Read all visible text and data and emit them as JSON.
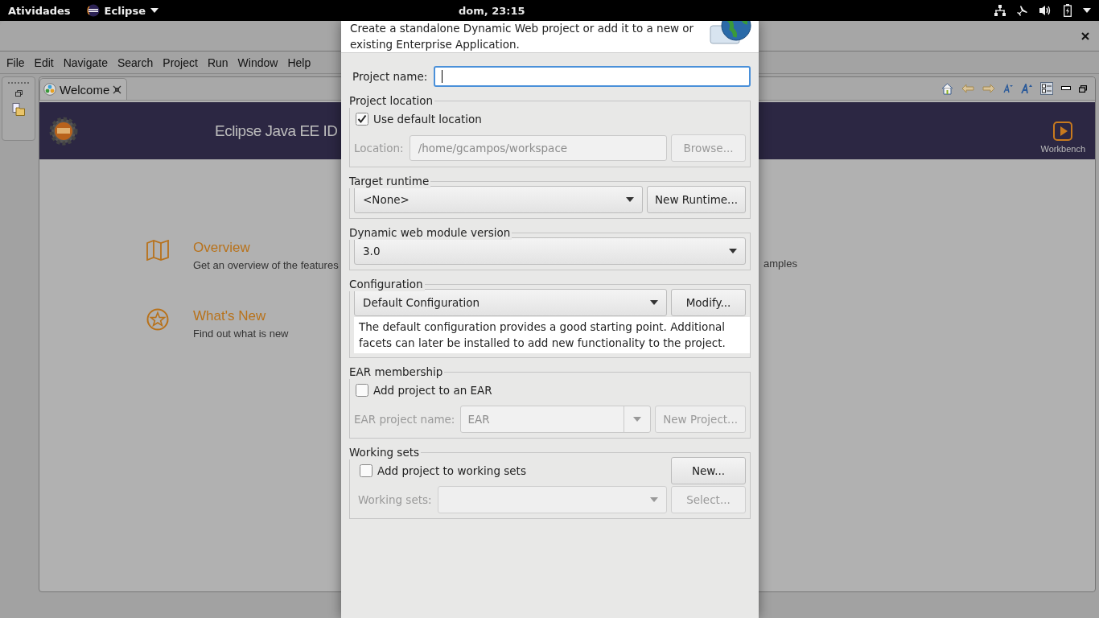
{
  "top_bar": {
    "activities": "Atividades",
    "app_menu": "Eclipse",
    "clock": "dom, 23:15"
  },
  "window": {
    "menu": [
      "File",
      "Edit",
      "Navigate",
      "Search",
      "Project",
      "Run",
      "Window",
      "Help"
    ]
  },
  "editor": {
    "tab": {
      "label": "Welcome",
      "selected": true
    },
    "banner_title": "Eclipse Java EE ID",
    "workbench": "Workbench",
    "items": [
      {
        "kind": "overview",
        "title": "Overview",
        "description": "Get an overview of the features"
      },
      {
        "kind": "whats_new",
        "title": "What's New",
        "description": "Find out what is new"
      }
    ],
    "right_fragment": "amples"
  },
  "dialog": {
    "description": "Create a standalone Dynamic Web project or add it to a new or existing Enterprise Application.",
    "project_name": {
      "label": "Project name:",
      "focused": true
    },
    "groups": [
      {
        "title": "Project location",
        "rows": [
          [
            {
              "kind": "checkbox",
              "label": "Use default location",
              "checked": true
            }
          ],
          [
            {
              "kind": "label",
              "text": "Location:",
              "disabled": true
            },
            {
              "kind": "field",
              "value": "/home/gcampos/workspace",
              "disabled": true
            },
            {
              "kind": "button",
              "label": "Browse...",
              "disabled": true
            }
          ]
        ]
      },
      {
        "title": "Target runtime",
        "rows": [
          [
            {
              "kind": "combo",
              "value": "<None>",
              "disabled": false
            },
            {
              "kind": "button",
              "label": "New Runtime...",
              "disabled": false
            }
          ]
        ]
      },
      {
        "title": "Dynamic web module version",
        "rows": [
          [
            {
              "kind": "combo",
              "value": "3.0",
              "disabled": false
            }
          ]
        ]
      },
      {
        "title": "Configuration",
        "rows": [
          [
            {
              "kind": "combo",
              "value": "Default Configuration",
              "disabled": false
            },
            {
              "kind": "button",
              "label": "Modify...",
              "disabled": false
            }
          ],
          [
            {
              "kind": "note",
              "text": "The default configuration provides a good starting point. Additional facets can later be installed to add new functionality to the project."
            }
          ]
        ]
      },
      {
        "title": "EAR membership",
        "rows": [
          [
            {
              "kind": "checkbox",
              "label": "Add project to an EAR",
              "checked": false
            }
          ],
          [
            {
              "kind": "label",
              "text": "EAR project name:",
              "disabled": true
            },
            {
              "kind": "entry_combo",
              "value": "EAR",
              "disabled": true
            },
            {
              "kind": "button",
              "label": "New Project...",
              "disabled": true
            }
          ]
        ]
      },
      {
        "title": "Working sets",
        "rows": [
          [
            {
              "kind": "checkbox",
              "label": "Add project to working sets",
              "checked": false
            },
            {
              "kind": "button",
              "label": "New...",
              "disabled": false
            }
          ],
          [
            {
              "kind": "label",
              "text": "Working sets:",
              "disabled": true
            },
            {
              "kind": "combo",
              "disabled": true
            },
            {
              "kind": "button",
              "label": "Select...",
              "disabled": true
            }
          ]
        ]
      }
    ]
  }
}
